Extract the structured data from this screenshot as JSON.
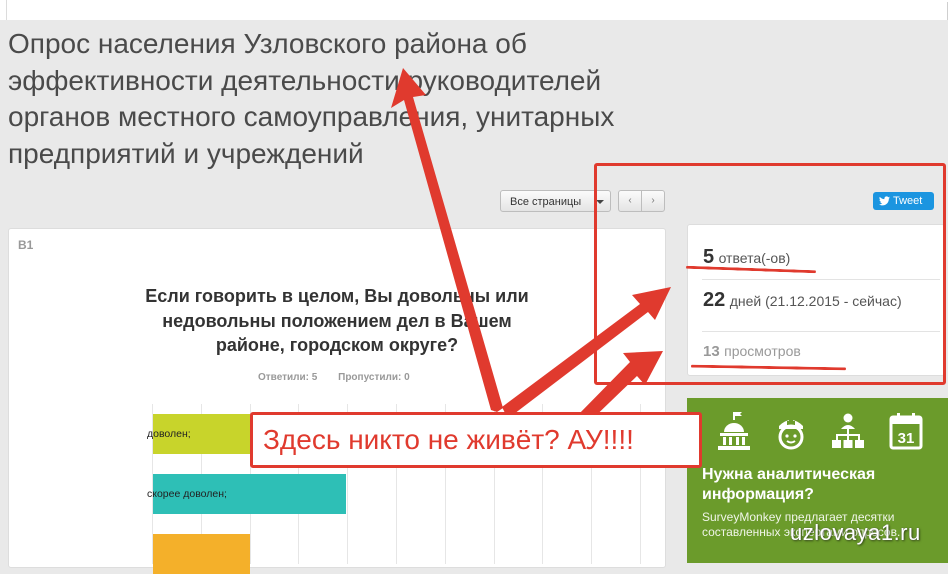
{
  "page": {
    "title": "Опрос населения Узловского района об эффективности деятельности руководителей органов местного самоуправления, унитарных предприятий и учреждений"
  },
  "toolbar": {
    "pages_dropdown": "Все страницы",
    "prev_icon": "‹",
    "next_icon": "›",
    "tweet_label": "Tweet"
  },
  "question": {
    "number": "В1",
    "text": "Если говорить в целом, Вы довольны или недовольны положением дел в Вашем районе, городском округе?",
    "answered": "Ответили: 5",
    "skipped": "Пропустили: 0"
  },
  "chart_data": {
    "type": "bar",
    "orientation": "horizontal",
    "categories": [
      "доволен;",
      "скорее доволен;",
      ""
    ],
    "values": [
      1,
      2,
      1
    ],
    "colors": [
      "#c8d42b",
      "#2ebfb6",
      "#f4b02a"
    ],
    "grid": true,
    "title": "",
    "xlabel": "",
    "ylabel": ""
  },
  "stats": {
    "responses_count": "5",
    "responses_label": "ответа(-ов)",
    "days_count": "22",
    "days_label": "дней (21.12.2015 - сейчас)",
    "views_count": "13",
    "views_label": "просмотров"
  },
  "promo": {
    "icons": [
      "capitol-icon",
      "nurse-icon",
      "org-chart-icon",
      "calendar-icon"
    ],
    "calendar_day": "31",
    "heading": "Нужна аналитическая информация?",
    "body": "SurveyMonkey предлагает десятки составленных экспертами опросов."
  },
  "annotation": {
    "text": "Здесь никто не живёт? АУ!!!!",
    "color": "#e03a2e"
  },
  "watermark": "uzlovaya1.ru"
}
